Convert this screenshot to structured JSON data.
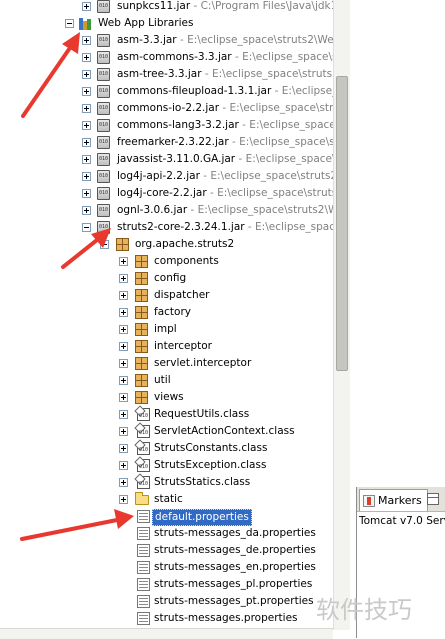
{
  "tree": {
    "top_entry": {
      "name": "sunpkcs11.jar",
      "path": " - C:\\Program Files\\Java\\jdk1.6"
    },
    "web_app_libraries": {
      "label": "Web App Libraries"
    },
    "jars": [
      {
        "name": "asm-3.3.jar",
        "path": " - E:\\eclipse_space\\struts2\\WebC"
      },
      {
        "name": "asm-commons-3.3.jar",
        "path": " - E:\\eclipse_space\\struts2\\W"
      },
      {
        "name": "asm-tree-3.3.jar",
        "path": " - E:\\eclipse_space\\struts2\\We"
      },
      {
        "name": "commons-fileupload-1.3.1.jar",
        "path": " - E:\\eclipse_spa"
      },
      {
        "name": "commons-io-2.2.jar",
        "path": " - E:\\eclipse_space\\struts2"
      },
      {
        "name": "commons-lang3-3.2.jar",
        "path": " - E:\\eclipse_space\\stru"
      },
      {
        "name": "freemarker-2.3.22.jar",
        "path": " - E:\\eclipse_space\\stru"
      },
      {
        "name": "javassist-3.11.0.GA.jar",
        "path": " - E:\\eclipse_space\\st"
      },
      {
        "name": "log4j-api-2.2.jar",
        "path": " - E:\\eclipse_space\\struts2\\V"
      },
      {
        "name": "log4j-core-2.2.jar",
        "path": " - E:\\eclipse_space\\struts2\\"
      },
      {
        "name": "ognl-3.0.6.jar",
        "path": " - E:\\eclipse_space\\struts2\\Wel"
      }
    ],
    "struts_core": {
      "name": "struts2-core-2.3.24.1.jar",
      "path": " - E:\\eclipse_space\\"
    },
    "package": {
      "name": "org.apache.struts2"
    },
    "subpackages": [
      "components",
      "config",
      "dispatcher",
      "factory",
      "impl",
      "interceptor",
      "servlet.interceptor",
      "util",
      "views"
    ],
    "classes": [
      "RequestUtils.class",
      "ServletActionContext.class",
      "StrutsConstants.class",
      "StrutsException.class",
      "StrutsStatics.class"
    ],
    "folder": {
      "name": "static"
    },
    "properties": [
      {
        "name": "default.properties",
        "selected": true
      },
      {
        "name": "struts-messages_da.properties"
      },
      {
        "name": "struts-messages_de.properties"
      },
      {
        "name": "struts-messages_en.properties"
      },
      {
        "name": "struts-messages_pl.properties"
      },
      {
        "name": "struts-messages_pt.properties"
      },
      {
        "name": "struts-messages.properties"
      }
    ]
  },
  "right_panel": {
    "markers_tab": "Markers",
    "server_entry": "Tomcat v7.0 Serve"
  },
  "watermark": "软件技巧",
  "colors": {
    "selection": "#316ac5",
    "path_text": "#808080",
    "arrow": "#e8392f"
  }
}
